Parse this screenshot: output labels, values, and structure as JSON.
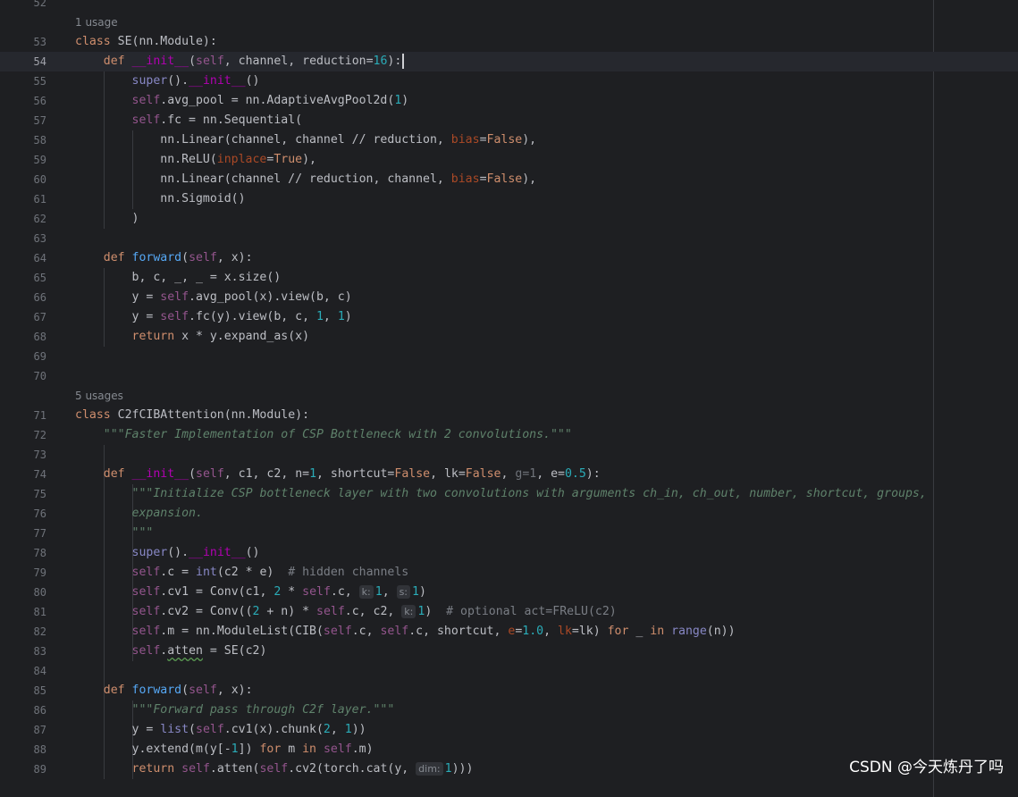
{
  "editor": {
    "hint_se": "1 usage",
    "hint_c2f": "5 usages",
    "line_numbers": [
      "52",
      "53",
      "54",
      "55",
      "56",
      "57",
      "58",
      "59",
      "60",
      "61",
      "62",
      "63",
      "64",
      "65",
      "66",
      "67",
      "68",
      "69",
      "70",
      "71",
      "72",
      "73",
      "74",
      "75",
      "76",
      "77",
      "78",
      "79",
      "80",
      "81",
      "82",
      "83",
      "84",
      "85",
      "86",
      "87",
      "88",
      "89"
    ],
    "inlay_hints": [
      "k:",
      "s:",
      "k:",
      "dim:"
    ]
  },
  "colors": {
    "background": "#1e1f22",
    "keyword": "#cf8e6d",
    "self": "#94558d",
    "function": "#56a8f5",
    "number": "#2aacb8",
    "docstring": "#5f826b"
  },
  "watermark": "CSDN @今天炼丹了吗"
}
